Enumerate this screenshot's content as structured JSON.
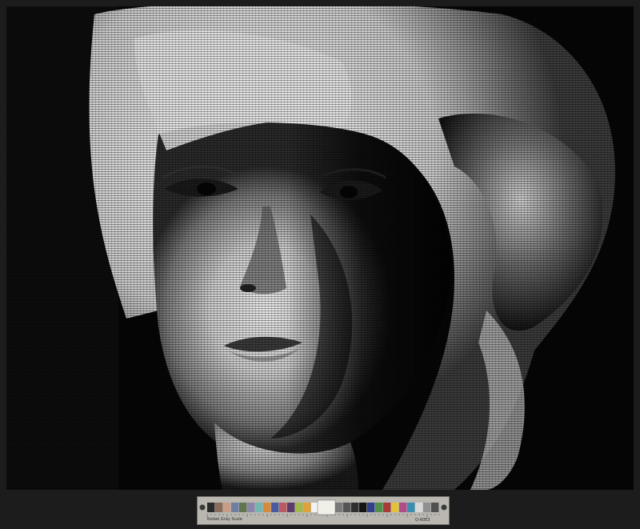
{
  "artwork": {
    "description_visible": false
  },
  "color_target": {
    "left_label": "Kodak Gray Scale",
    "right_label": "Q-60E3",
    "patch_colors": [
      "#2b2b2b",
      "#8a6b5c",
      "#c89d87",
      "#6d7fa0",
      "#5f7450",
      "#8a86ab",
      "#74b6b0",
      "#d58a3d",
      "#4b5a9e",
      "#bb5a64",
      "#5a3d6a",
      "#a2b84a",
      "#dda33a",
      "#f2f2f2",
      "#c8c8c8",
      "#a0a0a0",
      "#7a7a7a",
      "#555555",
      "#2f2f2f",
      "#141414",
      "#2f3f88",
      "#4f8f4a",
      "#a83a3a",
      "#e2c23a",
      "#b04b8c",
      "#3a8fb0",
      "#d8d8d8",
      "#909090",
      "#505050"
    ]
  }
}
